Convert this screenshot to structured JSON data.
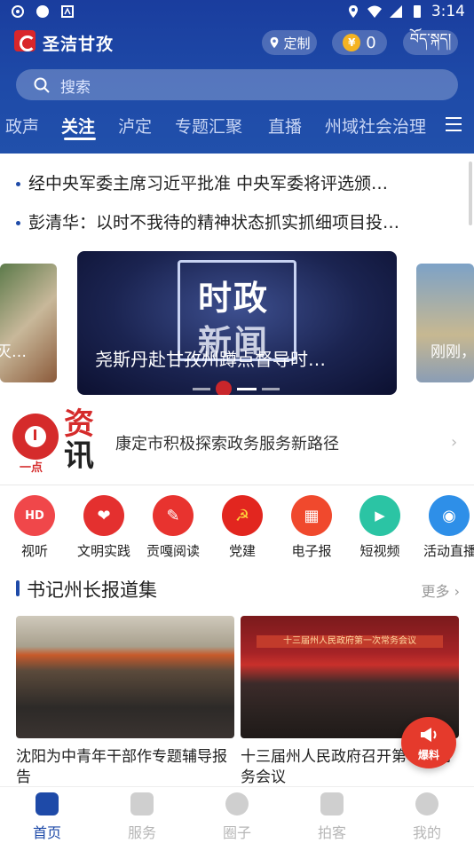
{
  "status_bar": {
    "time": "3:14"
  },
  "app": {
    "title": "圣洁甘孜",
    "locate_label": "定制",
    "coins": "0",
    "tibetan_label": "བོད་སྐད།"
  },
  "search": {
    "placeholder": "搜索"
  },
  "tabs": [
    {
      "label": "政声"
    },
    {
      "label": "关注",
      "active": true
    },
    {
      "label": "泸定"
    },
    {
      "label": "专题汇聚"
    },
    {
      "label": "直播"
    },
    {
      "label": "州域社会治理"
    }
  ],
  "headlines": [
    "经中央军委主席习近平批准 中央军委将评选颁…",
    "彭清华：以时不我待的精神状态抓实抓细项目投…"
  ],
  "carousel": {
    "left_caption": "灭…",
    "main_image_text_1": "时政",
    "main_image_text_2": "新闻",
    "main_caption": "尧斯丹赴甘孜州蹲点督导时…",
    "right_caption": "刚刚，"
  },
  "zixun": {
    "badge": "一点",
    "title_1": "资",
    "title_2": "讯",
    "text": "康定市积极探索政务服务新路径",
    "arrow": "›"
  },
  "quick_icons": [
    {
      "label": "视听",
      "glyph": "HD",
      "color": "#f0474a"
    },
    {
      "label": "文明实践",
      "glyph": "❤",
      "color": "#e4302f"
    },
    {
      "label": "贡嘎阅读",
      "glyph": "✎",
      "color": "#e8332f"
    },
    {
      "label": "党建",
      "glyph": "☭",
      "color": "#e2261f"
    },
    {
      "label": "电子报",
      "glyph": "▦",
      "color": "#f0492d"
    },
    {
      "label": "短视频",
      "glyph": "▶",
      "color": "#2bc4a4"
    },
    {
      "label": "活动直播",
      "glyph": "◉",
      "color": "#2e8fe8"
    }
  ],
  "section": {
    "title": "书记州长报道集",
    "more": "更多 ›"
  },
  "cards": [
    {
      "caption": "沈阳为中青年干部作专题辅导报告"
    },
    {
      "caption": "十三届州人民政府召开第一次常务会议",
      "banner": "十三届州人民政府第一次常务会议"
    }
  ],
  "fab": {
    "label": "爆料"
  },
  "bottom_nav": [
    {
      "label": "首页",
      "active": true
    },
    {
      "label": "服务"
    },
    {
      "label": "圈子"
    },
    {
      "label": "拍客"
    },
    {
      "label": "我的"
    }
  ]
}
